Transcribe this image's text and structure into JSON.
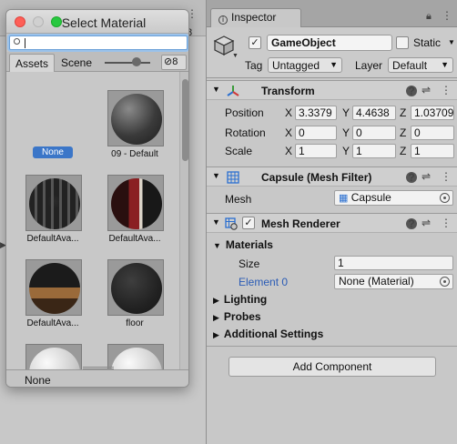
{
  "background": {
    "tab_fragment_top": "⋮",
    "tab_fragment": "8"
  },
  "inspector": {
    "tab_label": "Inspector",
    "gameobject": {
      "name": "GameObject",
      "active": true,
      "static_label": "Static",
      "static_checked": false,
      "tag_label": "Tag",
      "tag_value": "Untagged",
      "layer_label": "Layer",
      "layer_value": "Default"
    },
    "transform": {
      "title": "Transform",
      "position_label": "Position",
      "rotation_label": "Rotation",
      "scale_label": "Scale",
      "axes": [
        "X",
        "Y",
        "Z"
      ],
      "position": [
        "3.3379",
        "4.4638",
        "1.03709"
      ],
      "rotation": [
        "0",
        "0",
        "0"
      ],
      "scale": [
        "1",
        "1",
        "1"
      ]
    },
    "mesh_filter": {
      "title": "Capsule (Mesh Filter)",
      "mesh_label": "Mesh",
      "mesh_value": "Capsule"
    },
    "mesh_renderer": {
      "title": "Mesh Renderer",
      "enabled": true,
      "materials_label": "Materials",
      "size_label": "Size",
      "size_value": "1",
      "element_label": "Element 0",
      "element_value": "None (Material)",
      "lighting_label": "Lighting",
      "probes_label": "Probes",
      "additional_label": "Additional Settings"
    },
    "add_component_label": "Add Component"
  },
  "popup": {
    "title": "Select Material",
    "search_value": "",
    "tabs": [
      "Assets",
      "Scene"
    ],
    "active_tab": "Assets",
    "hidden_count": "8",
    "items": [
      {
        "label": "None",
        "selected": true,
        "style": "none"
      },
      {
        "label": "09 - Default",
        "selected": false,
        "style": "default"
      },
      {
        "label": "DefaultAva...",
        "selected": false,
        "style": "avatar-dark"
      },
      {
        "label": "DefaultAva...",
        "selected": false,
        "style": "avatar-red"
      },
      {
        "label": "DefaultAva...",
        "selected": false,
        "style": "avatar-brown"
      },
      {
        "label": "floor",
        "selected": false,
        "style": "floor"
      },
      {
        "label": "",
        "selected": false,
        "style": "white"
      },
      {
        "label": "",
        "selected": false,
        "style": "white"
      }
    ],
    "footer_text": "None"
  },
  "colors": {
    "selection_blue": "#3b76c8",
    "link_blue": "#2a5bb5",
    "traffic_red": "#fe5f57",
    "traffic_yellow": "#febc2e",
    "traffic_green": "#28c840"
  }
}
